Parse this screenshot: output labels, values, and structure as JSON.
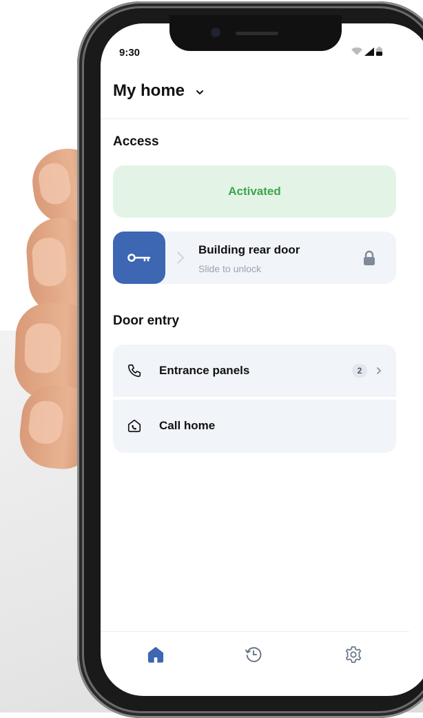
{
  "status_bar": {
    "time": "9:30"
  },
  "header": {
    "title": "My home"
  },
  "access": {
    "section_title": "Access",
    "status_label": "Activated",
    "door": {
      "name": "Building rear door",
      "hint": "Slide to unlock"
    }
  },
  "door_entry": {
    "section_title": "Door entry",
    "items": [
      {
        "label": "Entrance panels",
        "badge": "2",
        "icon": "phone-icon"
      },
      {
        "label": "Call home",
        "icon": "home-phone-icon"
      }
    ]
  },
  "bottom_nav": {
    "items": [
      {
        "name": "home",
        "icon": "home-icon",
        "active": true
      },
      {
        "name": "history",
        "icon": "history-icon",
        "active": false
      },
      {
        "name": "settings",
        "icon": "gear-icon",
        "active": false
      }
    ]
  },
  "colors": {
    "accent": "#3d66b3",
    "activated_bg": "#e3f4e6",
    "activated_text": "#3aa64a",
    "card_bg": "#f1f4f8"
  }
}
